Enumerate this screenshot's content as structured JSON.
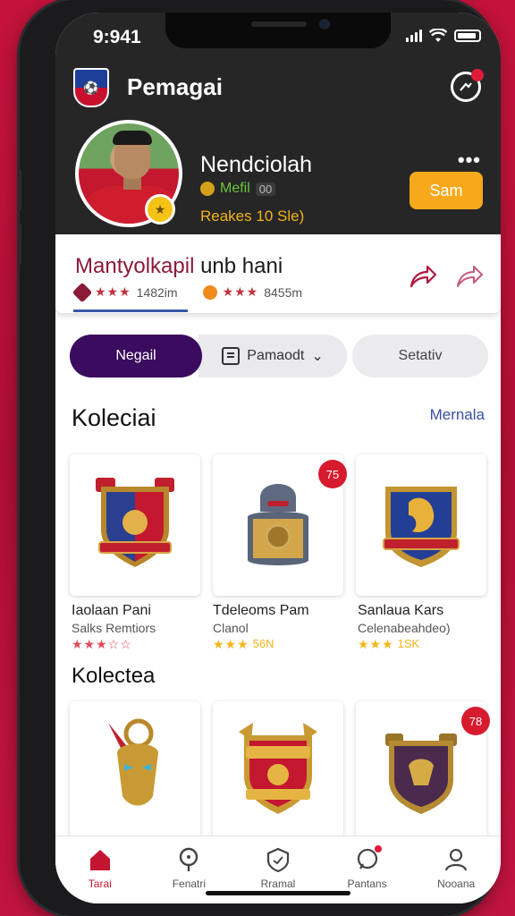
{
  "status_bar": {
    "time": "9:941"
  },
  "header": {
    "title": "Pemagai"
  },
  "profile": {
    "name": "Nendciolah",
    "coins_text": "Mefil",
    "coins_value": "00",
    "subtitle": "Reakes 10 Sle)",
    "action_label": "Sam"
  },
  "club": {
    "title_part1": "Mantyolkapil",
    "title_part2": " unb hani",
    "stat1_value": "1482im",
    "stat2_value": "8455m"
  },
  "tabs": {
    "active": "Negail",
    "middle": "Pamaodt",
    "third": "Setativ"
  },
  "section1": {
    "title": "Koleciai",
    "see_all": "Mernala"
  },
  "section2": {
    "title": "Kolectea"
  },
  "items_row1": [
    {
      "name": "Iaolaan Pani",
      "desc": "Salks Remtiors",
      "rating": "",
      "badge": ""
    },
    {
      "name": "Tdeleoms Pam",
      "desc": "Clanol",
      "rating": "56N",
      "badge": "75"
    },
    {
      "name": "Sanlaua Kars",
      "desc": "Celenabeahdeo)",
      "rating": "1SK",
      "badge": ""
    }
  ],
  "items_row2": [
    {
      "badge": ""
    },
    {
      "badge": ""
    },
    {
      "badge": "78"
    }
  ],
  "bottom_nav": [
    {
      "label": "Tarai"
    },
    {
      "label": "Fenatri"
    },
    {
      "label": "Rramal"
    },
    {
      "label": "Pantans"
    },
    {
      "label": "Nooana"
    }
  ],
  "colors": {
    "brand_red": "#c41530",
    "accent_yellow": "#f7a81b",
    "tab_purple": "#3a0b5e"
  }
}
